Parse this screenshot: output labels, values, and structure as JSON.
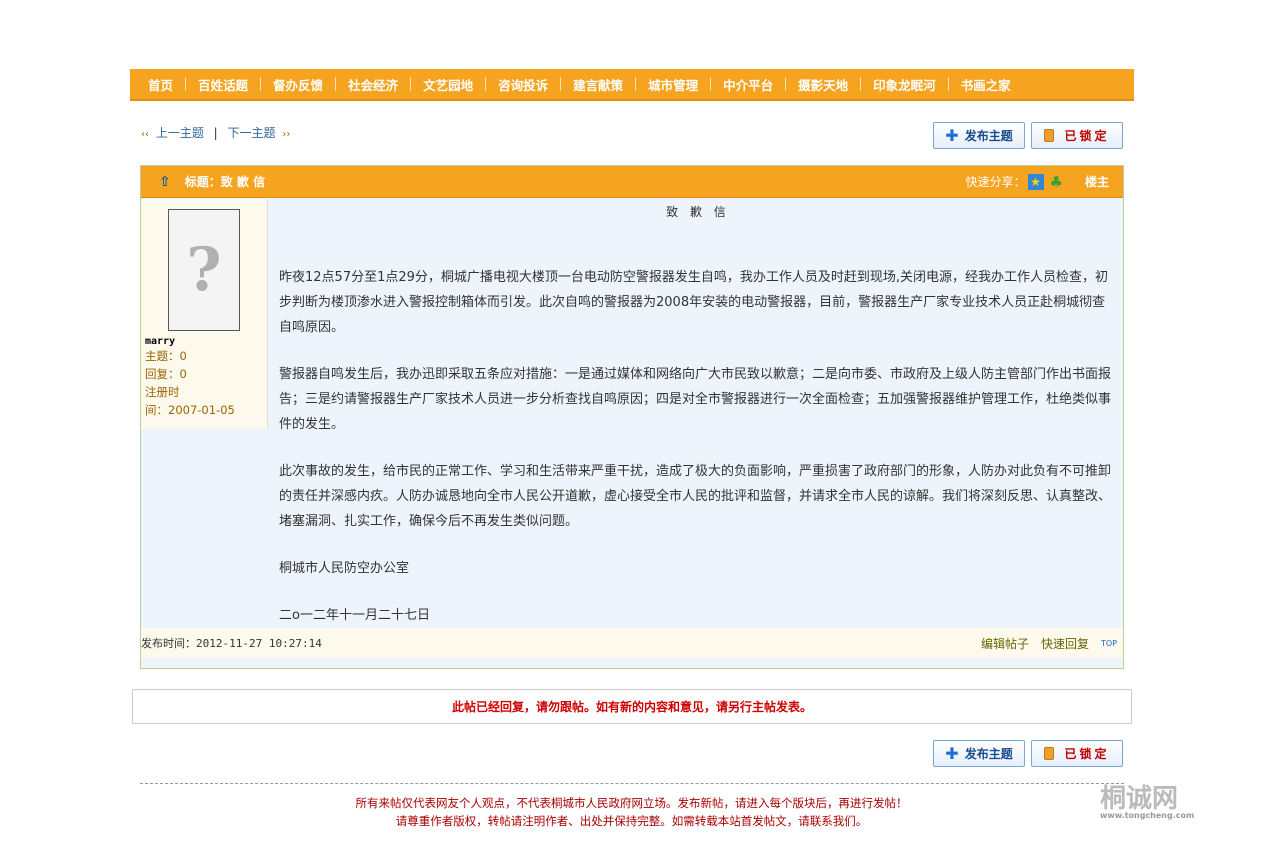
{
  "nav": {
    "items": [
      "首页",
      "百姓话题",
      "督办反馈",
      "社会经济",
      "文艺园地",
      "咨询投诉",
      "建言献策",
      "城市管理",
      "中介平台",
      "摄影天地",
      "印象龙眠河",
      "书画之家"
    ]
  },
  "topic_nav": {
    "prev_arrow": "‹‹",
    "prev_label": "上一主题",
    "sep": "|",
    "next_label": "下一主题",
    "next_arrow": "››"
  },
  "buttons": {
    "post_topic": "发布主题",
    "locked": "已锁定"
  },
  "post": {
    "header_title": "标题：致 歉 信",
    "share_label": "快速分享：",
    "floor_label": "楼主",
    "content_title": "致 歉 信",
    "paragraphs": [
      "昨夜12点57分至1点29分，桐城广播电视大楼顶一台电动防空警报器发生自鸣，我办工作人员及时赶到现场,关闭电源，经我办工作人员检查，初步判断为楼顶渗水进入警报控制箱体而引发。此次自鸣的警报器为2008年安装的电动警报器，目前，警报器生产厂家专业技术人员正赴桐城彻查自鸣原因。",
      "警报器自鸣发生后，我办迅即采取五条应对措施：一是通过媒体和网络向广大市民致以歉意；二是向市委、市政府及上级人防主管部门作出书面报告；三是约请警报器生产厂家技术人员进一步分析查找自鸣原因；四是对全市警报器进行一次全面检查；五加强警报器维护管理工作，杜绝类似事件的发生。",
      "此次事故的发生，给市民的正常工作、学习和生活带来严重干扰，造成了极大的负面影响，严重损害了政府部门的形象，人防办对此负有不可推卸的责任并深感内疚。人防办诚恳地向全市人民公开道歉，虚心接受全市人民的批评和监督，并请求全市人民的谅解。我们将深刻反思、认真整改、堵塞漏洞、扎实工作，确保今后不再发生类似问题。",
      "桐城市人民防空办公室",
      "二o一二年十一月二十七日"
    ],
    "post_time_label": "发布时间：",
    "post_time": "2012-11-27 10:27:14",
    "edit_label": "编辑帖子",
    "quick_reply_label": "快速回复",
    "top_label": "TOP"
  },
  "author": {
    "name": "marry",
    "topics_label": "主题：",
    "topics": "0",
    "replies_label": "回复：",
    "replies": "0",
    "reg_label_1": "注册时",
    "reg_label_2": "间：",
    "reg_date": "2007-01-05"
  },
  "notice": "此帖已经回复，请勿跟帖。如有新的内容和意见，请另行主帖发表。",
  "footer": {
    "line1": "所有来帖仅代表网友个人观点，不代表桐城市人民政府网立场。发布新帖，请进入每个版块后，再进行发帖！",
    "line2": "请尊重作者版权，转帖请注明作者、出处并保持完整。如需转载本站首发帖文，请联系我们。",
    "logo_text": "桐诚网",
    "logo_sub": "www.tongcheng.com"
  },
  "colors": {
    "nav_bg": "#f6a31f",
    "post_bg": "#eef4fb",
    "notice_text": "#d00000",
    "footer_text": "#aa0000"
  }
}
